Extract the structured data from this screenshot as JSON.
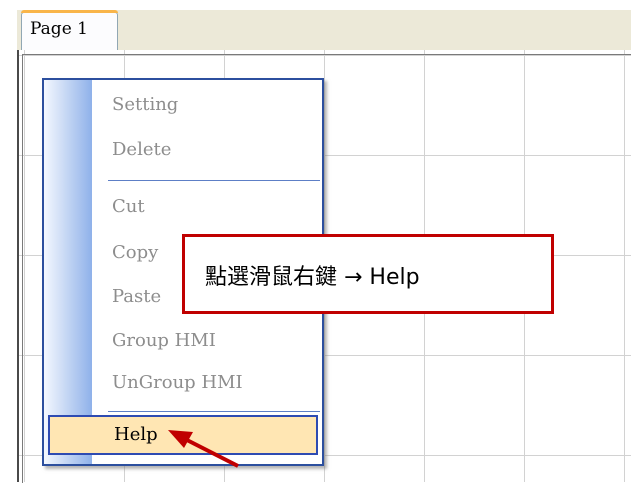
{
  "tabs": [
    {
      "label": "Page 1"
    }
  ],
  "context_menu": {
    "items": [
      "Setting",
      "Delete",
      "Cut",
      "Copy",
      "Paste",
      "Group HMI",
      "UnGroup HMI"
    ],
    "help_label": "Help"
  },
  "callout": {
    "text": "點選滑鼠右鍵  → Help"
  },
  "colors": {
    "callout_border": "#c00000",
    "arrow": "#c00000",
    "menu_border": "#2c4f9e",
    "help_highlight": "#ffe6b3",
    "disabled_text": "#8d8d8d"
  },
  "icons": {
    "pointer": "arrow-icon"
  }
}
